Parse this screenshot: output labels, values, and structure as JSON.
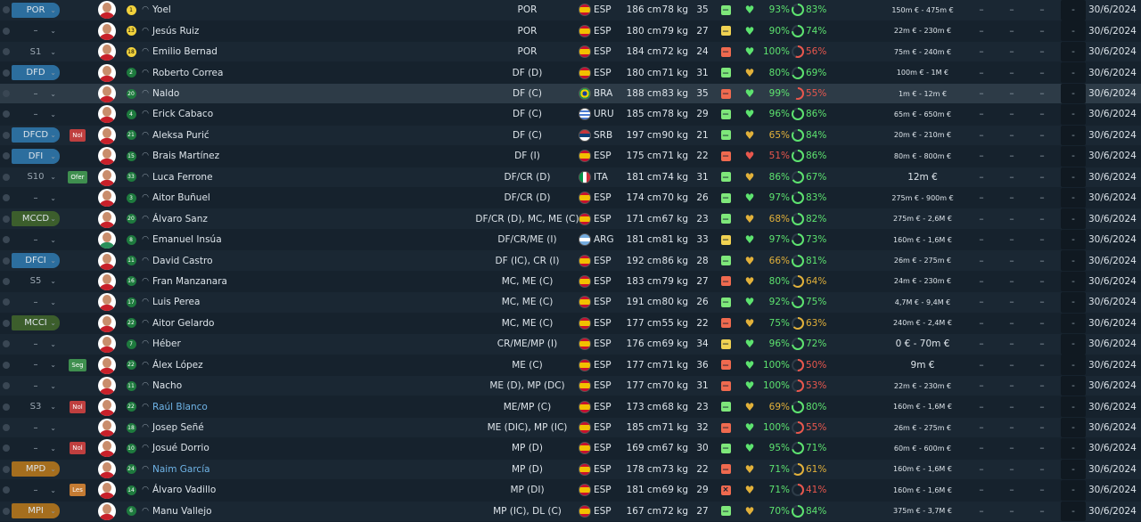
{
  "colors": {
    "pos_blue": "#2c6e9e",
    "pos_green": "#3c5e2c",
    "pos_orange": "#a56e1e",
    "pos_gray": "#2a3844",
    "tag_red": "#bf3f3f",
    "tag_green": "#3f8f4f",
    "tag_orange": "#c47b33",
    "good": "#5de36f",
    "mid": "#e2b13a",
    "bad": "#e9574d",
    "shirt": "#c8202a"
  },
  "rows": [
    {
      "pos": "POR",
      "pos_color": "blue",
      "tag": "",
      "face_shirt": "#c8202a",
      "hn": "1",
      "hn_color": "#f2d23c",
      "name": "Yoel",
      "name_blue": false,
      "position": "POR",
      "flag": "esp",
      "nat": "ESP",
      "height": "186 cm",
      "weight": "78 kg",
      "age": "35",
      "status": "green",
      "heart": "good",
      "cond": "93%",
      "cond_color": "good",
      "ring_pct": 0.83,
      "ring_color": "good",
      "sharp": "83%",
      "sharp_color": "good",
      "value": "150m € - 475m €",
      "value_big": false,
      "d1": "–",
      "d2": "–",
      "d3": "–",
      "d4": "-",
      "date": "30/6/2024"
    },
    {
      "pos": "–",
      "pos_color": "none",
      "tag": "",
      "face_shirt": "#c8202a",
      "hn": "13",
      "hn_color": "#f2d23c",
      "name": "Jesús Ruiz",
      "name_blue": false,
      "position": "POR",
      "flag": "esp",
      "nat": "ESP",
      "height": "180 cm",
      "weight": "79 kg",
      "age": "27",
      "status": "yellow",
      "heart": "good",
      "cond": "90%",
      "cond_color": "good",
      "ring_pct": 0.74,
      "ring_color": "good",
      "sharp": "74%",
      "sharp_color": "good",
      "value": "22m € - 230m €",
      "value_big": false,
      "d1": "–",
      "d2": "–",
      "d3": "–",
      "d4": "-",
      "date": "30/6/2024"
    },
    {
      "pos": "S1",
      "pos_color": "none",
      "tag": "",
      "face_shirt": "#c8202a",
      "hn": "18",
      "hn_color": "#f2d23c",
      "name": "Emilio Bernad",
      "name_blue": false,
      "position": "POR",
      "flag": "esp",
      "nat": "ESP",
      "height": "184 cm",
      "weight": "72 kg",
      "age": "24",
      "status": "red",
      "heart": "good",
      "cond": "100%",
      "cond_color": "good",
      "ring_pct": 0.56,
      "ring_color": "bad",
      "sharp": "56%",
      "sharp_color": "bad",
      "value": "75m € - 240m €",
      "value_big": false,
      "d1": "–",
      "d2": "–",
      "d3": "–",
      "d4": "-",
      "date": "30/6/2024"
    },
    {
      "pos": "DFD",
      "pos_color": "blue",
      "tag": "",
      "face_shirt": "#c8202a",
      "hn": "2",
      "hn_color": "#1e7a3e",
      "name": "Roberto Correa",
      "name_blue": false,
      "position": "DF (D)",
      "flag": "esp",
      "nat": "ESP",
      "height": "180 cm",
      "weight": "71 kg",
      "age": "31",
      "status": "green",
      "heart": "mid",
      "cond": "80%",
      "cond_color": "good",
      "ring_pct": 0.69,
      "ring_color": "good",
      "sharp": "69%",
      "sharp_color": "good",
      "value": "100m € - 1M €",
      "value_big": false,
      "d1": "–",
      "d2": "–",
      "d3": "–",
      "d4": "-",
      "date": "30/6/2024"
    },
    {
      "pos": "–",
      "pos_color": "none",
      "tag": "",
      "face_shirt": "#c8202a",
      "hn": "20",
      "hn_color": "#1e7a3e",
      "name": "Naldo",
      "name_blue": false,
      "position": "DF (C)",
      "flag": "bra",
      "nat": "BRA",
      "height": "188 cm",
      "weight": "83 kg",
      "age": "35",
      "status": "red",
      "heart": "good",
      "cond": "99%",
      "cond_color": "good",
      "ring_pct": 0.55,
      "ring_color": "bad",
      "sharp": "55%",
      "sharp_color": "bad",
      "value": "1m € - 12m €",
      "value_big": false,
      "d1": "–",
      "d2": "–",
      "d3": "–",
      "d4": "-",
      "date": "30/6/2024"
    },
    {
      "pos": "–",
      "pos_color": "none",
      "tag": "",
      "face_shirt": "#c8202a",
      "hn": "4",
      "hn_color": "#1e7a3e",
      "name": "Erick Cabaco",
      "name_blue": false,
      "position": "DF (C)",
      "flag": "uru",
      "nat": "URU",
      "height": "185 cm",
      "weight": "78 kg",
      "age": "29",
      "status": "green",
      "heart": "good",
      "cond": "96%",
      "cond_color": "good",
      "ring_pct": 0.86,
      "ring_color": "good",
      "sharp": "86%",
      "sharp_color": "good",
      "value": "65m € - 650m €",
      "value_big": false,
      "d1": "–",
      "d2": "–",
      "d3": "–",
      "d4": "-",
      "date": "30/6/2024"
    },
    {
      "pos": "DFCD",
      "pos_color": "blue",
      "tag": "Nol",
      "tag_color": "red",
      "face_shirt": "#c8202a",
      "hn": "21",
      "hn_color": "#1e7a3e",
      "name": "Aleksa Purić",
      "name_blue": false,
      "position": "DF (C)",
      "flag": "srb",
      "nat": "SRB",
      "height": "197 cm",
      "weight": "90 kg",
      "age": "21",
      "status": "green",
      "heart": "mid",
      "cond": "65%",
      "cond_color": "mid",
      "ring_pct": 0.84,
      "ring_color": "good",
      "sharp": "84%",
      "sharp_color": "good",
      "value": "20m € - 210m €",
      "value_big": false,
      "d1": "–",
      "d2": "–",
      "d3": "–",
      "d4": "-",
      "date": "30/6/2024"
    },
    {
      "pos": "DFI",
      "pos_color": "blue",
      "tag": "",
      "face_shirt": "#c8202a",
      "hn": "15",
      "hn_color": "#1e7a3e",
      "name": "Brais Martínez",
      "name_blue": false,
      "position": "DF (I)",
      "flag": "esp",
      "nat": "ESP",
      "height": "175 cm",
      "weight": "71 kg",
      "age": "22",
      "status": "red",
      "heart": "bad",
      "cond": "51%",
      "cond_color": "bad",
      "ring_pct": 0.86,
      "ring_color": "good",
      "sharp": "86%",
      "sharp_color": "good",
      "value": "80m € - 800m €",
      "value_big": false,
      "d1": "–",
      "d2": "–",
      "d3": "–",
      "d4": "-",
      "date": "30/6/2024"
    },
    {
      "pos": "S10",
      "pos_color": "none",
      "tag": "Ofer",
      "tag_color": "green",
      "face_shirt": "#c8202a",
      "hn": "33",
      "hn_color": "#1e7a3e",
      "name": "Luca Ferrone",
      "name_blue": false,
      "position": "DF/CR (D)",
      "flag": "ita",
      "nat": "ITA",
      "height": "181 cm",
      "weight": "74 kg",
      "age": "31",
      "status": "green",
      "heart": "mid",
      "cond": "86%",
      "cond_color": "good",
      "ring_pct": 0.67,
      "ring_color": "good",
      "sharp": "67%",
      "sharp_color": "good",
      "value": "12m €",
      "value_big": true,
      "d1": "–",
      "d2": "–",
      "d3": "–",
      "d4": "-",
      "date": "30/6/2024"
    },
    {
      "pos": "–",
      "pos_color": "none",
      "tag": "",
      "face_shirt": "#c8202a",
      "hn": "3",
      "hn_color": "#1e7a3e",
      "name": "Aitor Buñuel",
      "name_blue": false,
      "position": "DF/CR (D)",
      "flag": "esp",
      "nat": "ESP",
      "height": "174 cm",
      "weight": "70 kg",
      "age": "26",
      "status": "green",
      "heart": "good",
      "cond": "97%",
      "cond_color": "good",
      "ring_pct": 0.83,
      "ring_color": "good",
      "sharp": "83%",
      "sharp_color": "good",
      "value": "275m € - 900m €",
      "value_big": false,
      "d1": "–",
      "d2": "–",
      "d3": "–",
      "d4": "-",
      "date": "30/6/2024"
    },
    {
      "pos": "MCCD",
      "pos_color": "green",
      "tag": "",
      "face_shirt": "#c8202a",
      "hn": "20",
      "hn_color": "#1e7a3e",
      "name": "Álvaro Sanz",
      "name_blue": false,
      "position": "DF/CR (D), MC, ME (C)",
      "flag": "esp",
      "nat": "ESP",
      "height": "171 cm",
      "weight": "67 kg",
      "age": "23",
      "status": "green",
      "heart": "mid",
      "cond": "68%",
      "cond_color": "mid",
      "ring_pct": 0.82,
      "ring_color": "good",
      "sharp": "82%",
      "sharp_color": "good",
      "value": "275m € - 2,6M €",
      "value_big": false,
      "d1": "–",
      "d2": "–",
      "d3": "–",
      "d4": "-",
      "date": "30/6/2024"
    },
    {
      "pos": "–",
      "pos_color": "none",
      "tag": "",
      "face_shirt": "#2a8f5a",
      "hn": "8",
      "hn_color": "#1e7a3e",
      "name": "Emanuel Insúa",
      "name_blue": false,
      "position": "DF/CR/ME (I)",
      "flag": "arg",
      "nat": "ARG",
      "height": "181 cm",
      "weight": "81 kg",
      "age": "33",
      "status": "yellow",
      "heart": "good",
      "cond": "97%",
      "cond_color": "good",
      "ring_pct": 0.73,
      "ring_color": "good",
      "sharp": "73%",
      "sharp_color": "good",
      "value": "160m € - 1,6M €",
      "value_big": false,
      "d1": "–",
      "d2": "–",
      "d3": "–",
      "d4": "-",
      "date": "30/6/2024"
    },
    {
      "pos": "DFCI",
      "pos_color": "blue",
      "tag": "",
      "face_shirt": "#c8202a",
      "hn": "11",
      "hn_color": "#1e7a3e",
      "name": "David Castro",
      "name_blue": false,
      "position": "DF (IC), CR (I)",
      "flag": "esp",
      "nat": "ESP",
      "height": "192 cm",
      "weight": "86 kg",
      "age": "28",
      "status": "green",
      "heart": "mid",
      "cond": "66%",
      "cond_color": "mid",
      "ring_pct": 0.81,
      "ring_color": "good",
      "sharp": "81%",
      "sharp_color": "good",
      "value": "26m € - 275m €",
      "value_big": false,
      "d1": "–",
      "d2": "–",
      "d3": "–",
      "d4": "-",
      "date": "30/6/2024"
    },
    {
      "pos": "S5",
      "pos_color": "none",
      "tag": "",
      "face_shirt": "#c8202a",
      "hn": "16",
      "hn_color": "#1e7a3e",
      "name": "Fran Manzanara",
      "name_blue": false,
      "position": "MC, ME (C)",
      "flag": "esp",
      "nat": "ESP",
      "height": "183 cm",
      "weight": "79 kg",
      "age": "27",
      "status": "red",
      "heart": "mid",
      "cond": "80%",
      "cond_color": "good",
      "ring_pct": 0.64,
      "ring_color": "mid",
      "sharp": "64%",
      "sharp_color": "mid",
      "value": "24m € - 230m €",
      "value_big": false,
      "d1": "–",
      "d2": "–",
      "d3": "–",
      "d4": "-",
      "date": "30/6/2024"
    },
    {
      "pos": "–",
      "pos_color": "none",
      "tag": "",
      "face_shirt": "#c8202a",
      "hn": "17",
      "hn_color": "#1e7a3e",
      "name": "Luis Perea",
      "name_blue": false,
      "position": "MC, ME (C)",
      "flag": "esp",
      "nat": "ESP",
      "height": "191 cm",
      "weight": "80 kg",
      "age": "26",
      "status": "green",
      "heart": "good",
      "cond": "92%",
      "cond_color": "good",
      "ring_pct": 0.75,
      "ring_color": "good",
      "sharp": "75%",
      "sharp_color": "good",
      "value": "4,7M € - 9,4M €",
      "value_big": false,
      "d1": "–",
      "d2": "–",
      "d3": "–",
      "d4": "-",
      "date": "30/6/2024"
    },
    {
      "pos": "MCCI",
      "pos_color": "green",
      "tag": "",
      "face_shirt": "#c8202a",
      "hn": "22",
      "hn_color": "#1e7a3e",
      "name": "Aitor Gelardo",
      "name_blue": false,
      "position": "MC, ME (C)",
      "flag": "esp",
      "nat": "ESP",
      "height": "177 cm",
      "weight": "55 kg",
      "age": "22",
      "status": "red",
      "heart": "mid",
      "cond": "75%",
      "cond_color": "good",
      "ring_pct": 0.63,
      "ring_color": "mid",
      "sharp": "63%",
      "sharp_color": "mid",
      "value": "240m € - 2,4M €",
      "value_big": false,
      "d1": "–",
      "d2": "–",
      "d3": "–",
      "d4": "-",
      "date": "30/6/2024"
    },
    {
      "pos": "–",
      "pos_color": "none",
      "tag": "",
      "face_shirt": "#c8202a",
      "hn": "7",
      "hn_color": "#1e7a3e",
      "name": "Héber",
      "name_blue": false,
      "position": "CR/ME/MP (I)",
      "flag": "esp",
      "nat": "ESP",
      "height": "176 cm",
      "weight": "69 kg",
      "age": "34",
      "status": "yellow",
      "heart": "good",
      "cond": "96%",
      "cond_color": "good",
      "ring_pct": 0.72,
      "ring_color": "good",
      "sharp": "72%",
      "sharp_color": "good",
      "value": "0 € - 70m €",
      "value_big": true,
      "d1": "–",
      "d2": "–",
      "d3": "–",
      "d4": "-",
      "date": "30/6/2024"
    },
    {
      "pos": "–",
      "pos_color": "none",
      "tag": "Seg",
      "tag_color": "green",
      "face_shirt": "#c8202a",
      "hn": "22",
      "hn_color": "#1e7a3e",
      "name": "Álex López",
      "name_blue": false,
      "position": "ME (C)",
      "flag": "esp",
      "nat": "ESP",
      "height": "177 cm",
      "weight": "71 kg",
      "age": "36",
      "status": "red",
      "heart": "good",
      "cond": "100%",
      "cond_color": "good",
      "ring_pct": 0.5,
      "ring_color": "bad",
      "sharp": "50%",
      "sharp_color": "bad",
      "value": "9m €",
      "value_big": true,
      "d1": "–",
      "d2": "–",
      "d3": "–",
      "d4": "-",
      "date": "30/6/2024"
    },
    {
      "pos": "–",
      "pos_color": "none",
      "tag": "",
      "face_shirt": "#c8202a",
      "hn": "11",
      "hn_color": "#1e7a3e",
      "name": "Nacho",
      "name_blue": false,
      "position": "ME (D), MP (DC)",
      "flag": "esp",
      "nat": "ESP",
      "height": "177 cm",
      "weight": "70 kg",
      "age": "31",
      "status": "red",
      "heart": "good",
      "cond": "100%",
      "cond_color": "good",
      "ring_pct": 0.53,
      "ring_color": "bad",
      "sharp": "53%",
      "sharp_color": "bad",
      "value": "22m € - 230m €",
      "value_big": false,
      "d1": "–",
      "d2": "–",
      "d3": "–",
      "d4": "-",
      "date": "30/6/2024"
    },
    {
      "pos": "S3",
      "pos_color": "none",
      "tag": "Nol",
      "tag_color": "red",
      "face_shirt": "#c8202a",
      "hn": "22",
      "hn_color": "#1e7a3e",
      "name": "Raúl Blanco",
      "name_blue": true,
      "position": "ME/MP (C)",
      "flag": "esp",
      "nat": "ESP",
      "height": "173 cm",
      "weight": "68 kg",
      "age": "23",
      "status": "green",
      "heart": "mid",
      "cond": "69%",
      "cond_color": "mid",
      "ring_pct": 0.8,
      "ring_color": "good",
      "sharp": "80%",
      "sharp_color": "good",
      "value": "160m € - 1,6M €",
      "value_big": false,
      "d1": "–",
      "d2": "–",
      "d3": "–",
      "d4": "-",
      "date": "30/6/2024"
    },
    {
      "pos": "–",
      "pos_color": "none",
      "tag": "",
      "face_shirt": "#c8202a",
      "hn": "18",
      "hn_color": "#1e7a3e",
      "name": "Josep Señé",
      "name_blue": false,
      "position": "ME (DIC), MP (IC)",
      "flag": "esp",
      "nat": "ESP",
      "height": "185 cm",
      "weight": "71 kg",
      "age": "32",
      "status": "red",
      "heart": "good",
      "cond": "100%",
      "cond_color": "good",
      "ring_pct": 0.55,
      "ring_color": "bad",
      "sharp": "55%",
      "sharp_color": "bad",
      "value": "26m € - 275m €",
      "value_big": false,
      "d1": "–",
      "d2": "–",
      "d3": "–",
      "d4": "-",
      "date": "30/6/2024"
    },
    {
      "pos": "–",
      "pos_color": "none",
      "tag": "Nol",
      "tag_color": "red",
      "face_shirt": "#c8202a",
      "hn": "10",
      "hn_color": "#1e7a3e",
      "name": "Josué Dorrio",
      "name_blue": false,
      "position": "MP (D)",
      "flag": "esp",
      "nat": "ESP",
      "height": "169 cm",
      "weight": "67 kg",
      "age": "30",
      "status": "green",
      "heart": "good",
      "cond": "95%",
      "cond_color": "good",
      "ring_pct": 0.71,
      "ring_color": "good",
      "sharp": "71%",
      "sharp_color": "good",
      "value": "60m € - 600m €",
      "value_big": false,
      "d1": "–",
      "d2": "–",
      "d3": "–",
      "d4": "-",
      "date": "30/6/2024"
    },
    {
      "pos": "MPD",
      "pos_color": "orange",
      "tag": "",
      "face_shirt": "#c8202a",
      "hn": "24",
      "hn_color": "#1e7a3e",
      "name": "Naim García",
      "name_blue": true,
      "position": "MP (D)",
      "flag": "esp",
      "nat": "ESP",
      "height": "178 cm",
      "weight": "73 kg",
      "age": "22",
      "status": "red",
      "heart": "mid",
      "cond": "71%",
      "cond_color": "good",
      "ring_pct": 0.61,
      "ring_color": "mid",
      "sharp": "61%",
      "sharp_color": "mid",
      "value": "160m € - 1,6M €",
      "value_big": false,
      "d1": "–",
      "d2": "–",
      "d3": "–",
      "d4": "-",
      "date": "30/6/2024"
    },
    {
      "pos": "–",
      "pos_color": "none",
      "tag": "Les",
      "tag_color": "orange",
      "face_shirt": "#c8202a",
      "hn": "14",
      "hn_color": "#1e7a3e",
      "name": "Álvaro Vadillo",
      "name_blue": false,
      "position": "MP (DI)",
      "flag": "esp",
      "nat": "ESP",
      "height": "181 cm",
      "weight": "69 kg",
      "age": "29",
      "status": "redx",
      "heart": "mid",
      "cond": "71%",
      "cond_color": "good",
      "ring_pct": 0.41,
      "ring_color": "bad",
      "sharp": "41%",
      "sharp_color": "bad",
      "value": "160m € - 1,6M €",
      "value_big": false,
      "d1": "–",
      "d2": "–",
      "d3": "–",
      "d4": "-",
      "date": "30/6/2024"
    },
    {
      "pos": "MPI",
      "pos_color": "orange",
      "tag": "",
      "face_shirt": "#c8202a",
      "hn": "6",
      "hn_color": "#1e7a3e",
      "name": "Manu Vallejo",
      "name_blue": false,
      "position": "MP (IC), DL (C)",
      "flag": "esp",
      "nat": "ESP",
      "height": "167 cm",
      "weight": "72 kg",
      "age": "27",
      "status": "green",
      "heart": "mid",
      "cond": "70%",
      "cond_color": "good",
      "ring_pct": 0.84,
      "ring_color": "good",
      "sharp": "84%",
      "sharp_color": "good",
      "value": "375m € - 3,7M €",
      "value_big": false,
      "d1": "–",
      "d2": "–",
      "d3": "–",
      "d4": "-",
      "date": "30/6/2024"
    }
  ]
}
